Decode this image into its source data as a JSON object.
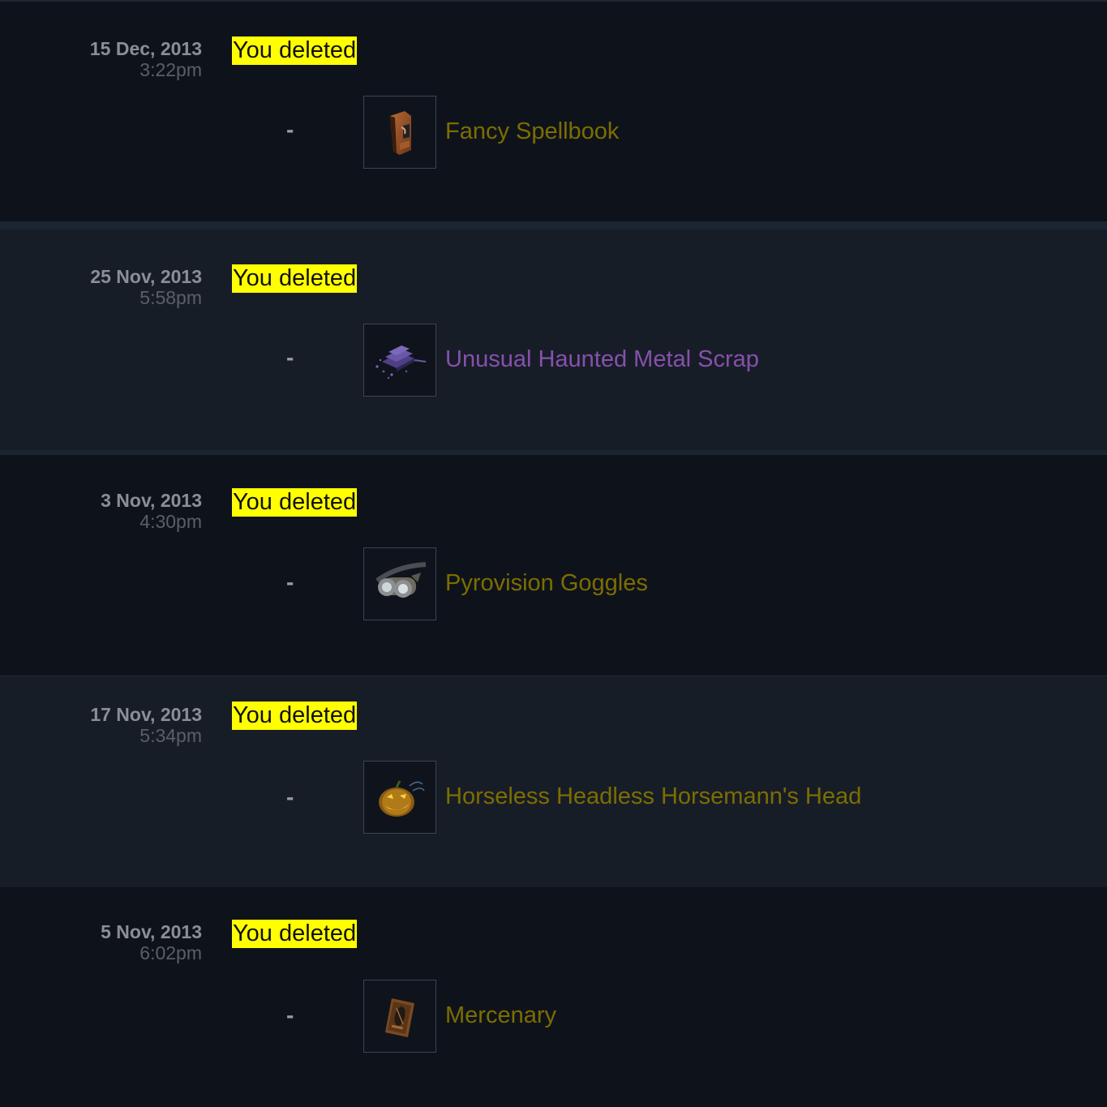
{
  "history": [
    {
      "date": "15 Dec, 2013",
      "time": "3:22pm",
      "event": "You deleted",
      "separator": "-",
      "item": {
        "name": "Fancy Spellbook",
        "icon": "spellbook-icon",
        "color": "#7d6d00"
      }
    },
    {
      "date": "25 Nov, 2013",
      "time": "5:58pm",
      "event": "You deleted",
      "separator": "-",
      "item": {
        "name": "Unusual Haunted Metal Scrap",
        "icon": "metal-scrap-icon",
        "color": "#8650ac"
      }
    },
    {
      "date": "3 Nov, 2013",
      "time": "4:30pm",
      "event": "You deleted",
      "separator": "-",
      "item": {
        "name": "Pyrovision Goggles",
        "icon": "goggles-icon",
        "color": "#7d6d00"
      }
    },
    {
      "date": "17 Nov, 2013",
      "time": "5:34pm",
      "event": "You deleted",
      "separator": "-",
      "item": {
        "name": "Horseless Headless Horsemann's Head",
        "icon": "pumpkin-head-icon",
        "color": "#7d6d00"
      }
    },
    {
      "date": "5 Nov, 2013",
      "time": "6:02pm",
      "event": "You deleted",
      "separator": "-",
      "item": {
        "name": "Mercenary",
        "icon": "badge-icon",
        "color": "#7d6d00"
      }
    }
  ],
  "colors": {
    "highlight": "#ffff00",
    "unique_quality": "#7d6d00",
    "unusual_quality": "#8650ac"
  }
}
